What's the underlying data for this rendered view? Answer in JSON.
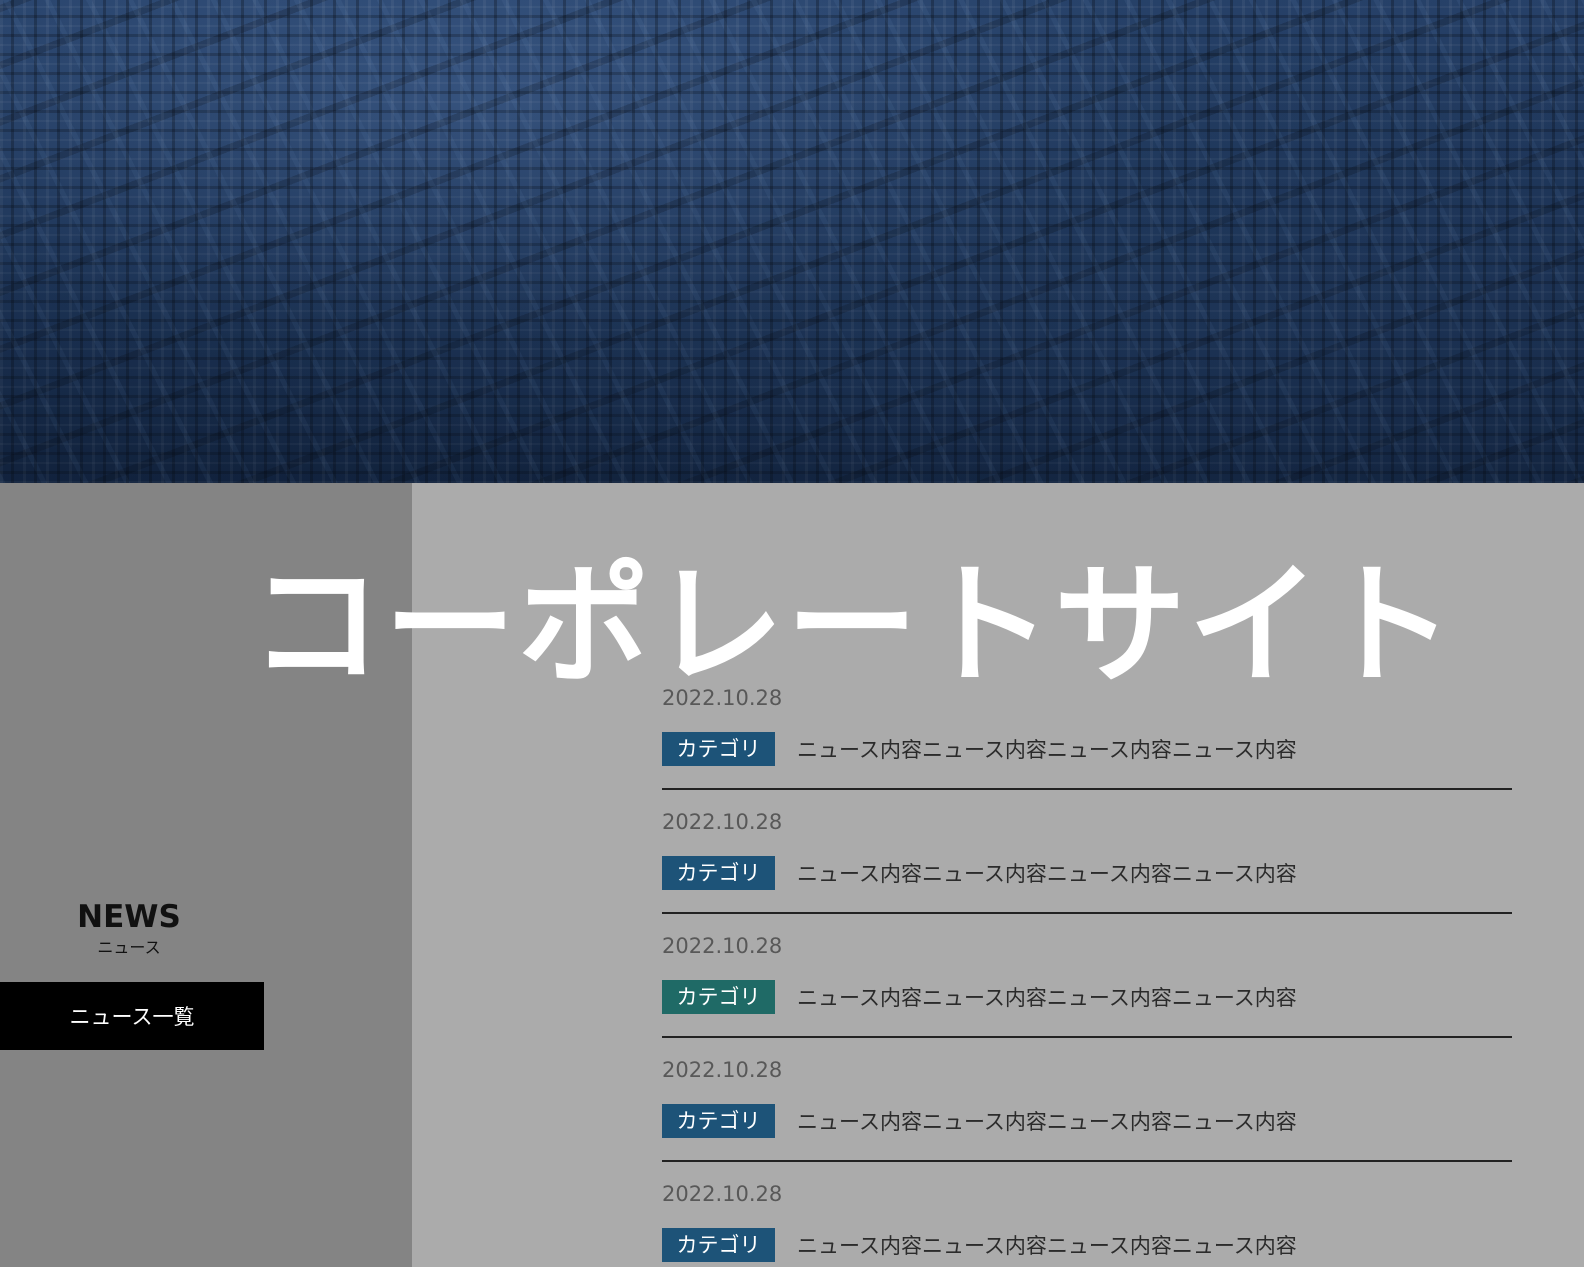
{
  "site_title": "コーポレートサイト",
  "news_section": {
    "heading_en": "NEWS",
    "heading_ja": "ニュース",
    "list_button": "ニュース一覧"
  },
  "colors": {
    "category_blue": "#1d5378",
    "category_teal": "#1f6a66",
    "sidebar_bg": "#848484",
    "content_bg": "#ababab"
  },
  "news_items": [
    {
      "date": "2022.10.28",
      "category": "カテゴリ",
      "text": "ニュース内容ニュース内容ニュース内容ニュース内容"
    },
    {
      "date": "2022.10.28",
      "category": "カテゴリ",
      "text": "ニュース内容ニュース内容ニュース内容ニュース内容"
    },
    {
      "date": "2022.10.28",
      "category": "カテゴリ",
      "text": "ニュース内容ニュース内容ニュース内容ニュース内容"
    },
    {
      "date": "2022.10.28",
      "category": "カテゴリ",
      "text": "ニュース内容ニュース内容ニュース内容ニュース内容"
    },
    {
      "date": "2022.10.28",
      "category": "カテゴリ",
      "text": "ニュース内容ニュース内容ニュース内容ニュース内容"
    }
  ]
}
